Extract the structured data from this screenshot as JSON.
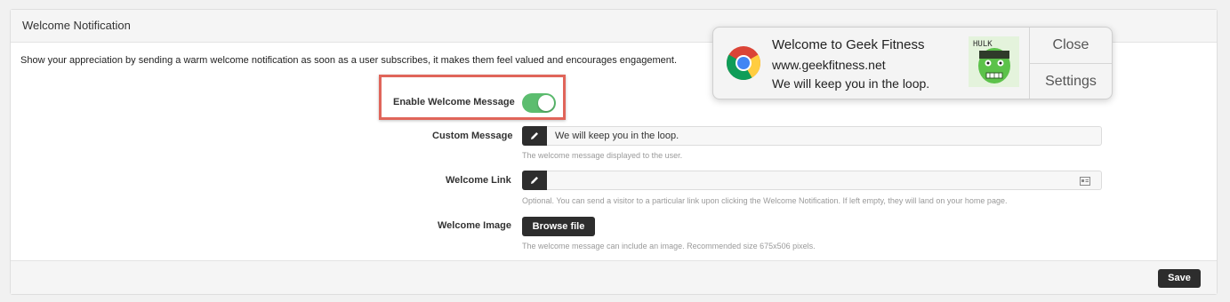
{
  "panel": {
    "title": "Welcome Notification",
    "intro": "Show your appreciation by sending a warm welcome notification as soon as a user subscribes, it makes them feel valued and encourages engagement."
  },
  "form": {
    "enable": {
      "label": "Enable Welcome Message",
      "enabled": true
    },
    "custom_message": {
      "label": "Custom Message",
      "value": "We will keep you in the loop.",
      "help": "The welcome message displayed to the user."
    },
    "welcome_link": {
      "label": "Welcome Link",
      "value": "",
      "help": "Optional. You can send a visitor to a particular link upon clicking the Welcome Notification. If left empty, they will land on your home page."
    },
    "welcome_image": {
      "label": "Welcome Image",
      "button": "Browse file",
      "help": "The welcome message can include an image. Recommended size 675x506 pixels."
    }
  },
  "footer": {
    "save_label": "Save"
  },
  "notification": {
    "title": "Welcome to Geek Fitness",
    "site": "www.geekfitness.net",
    "message": "We will keep you in the loop.",
    "close_label": "Close",
    "settings_label": "Settings",
    "browser_icon": "chrome-icon",
    "image_text": "HULK"
  },
  "colors": {
    "toggle_on": "#5cbd6f",
    "highlight": "#e0655a",
    "dark_button": "#2d2d2d"
  }
}
